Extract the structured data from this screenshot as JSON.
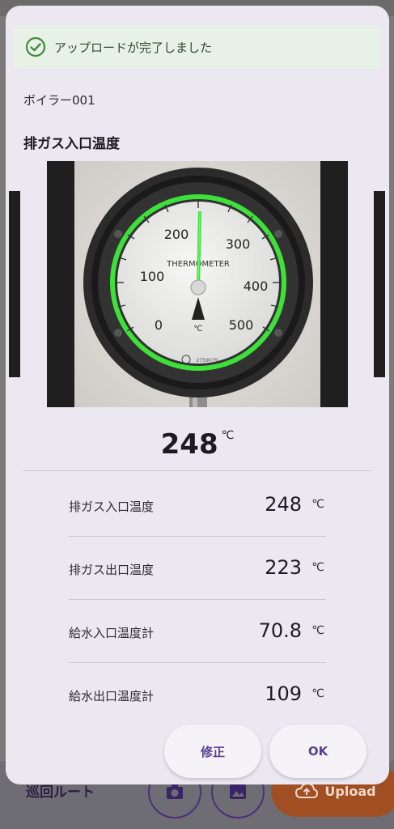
{
  "background": {
    "route_label": "巡回ルート",
    "upload_label": "Upload"
  },
  "toast": {
    "message": "アップロードが完了しました",
    "icon": "check-circle-icon",
    "color": "#3f8a3a"
  },
  "device": {
    "name": "ボイラー001"
  },
  "gauge": {
    "title": "排ガス入口温度",
    "dial_label": "THERMOMETER",
    "scale": [
      "0",
      "100",
      "200",
      "300",
      "400",
      "500"
    ],
    "unit_mark": "℃",
    "serial": "2759079"
  },
  "reading": {
    "value": "248",
    "unit": "℃"
  },
  "measurements": [
    {
      "label": "排ガス入口温度",
      "value": "248",
      "unit": "℃"
    },
    {
      "label": "排ガス出口温度",
      "value": "223",
      "unit": "℃"
    },
    {
      "label": "給水入口温度計",
      "value": "70.8",
      "unit": "℃"
    },
    {
      "label": "給水出口温度計",
      "value": "109",
      "unit": "℃"
    }
  ],
  "actions": {
    "edit_label": "修正",
    "ok_label": "OK"
  },
  "colors": {
    "accent": "#5a3f8e",
    "detection_ring": "#3ee03a",
    "upload_button": "#a04e22"
  }
}
